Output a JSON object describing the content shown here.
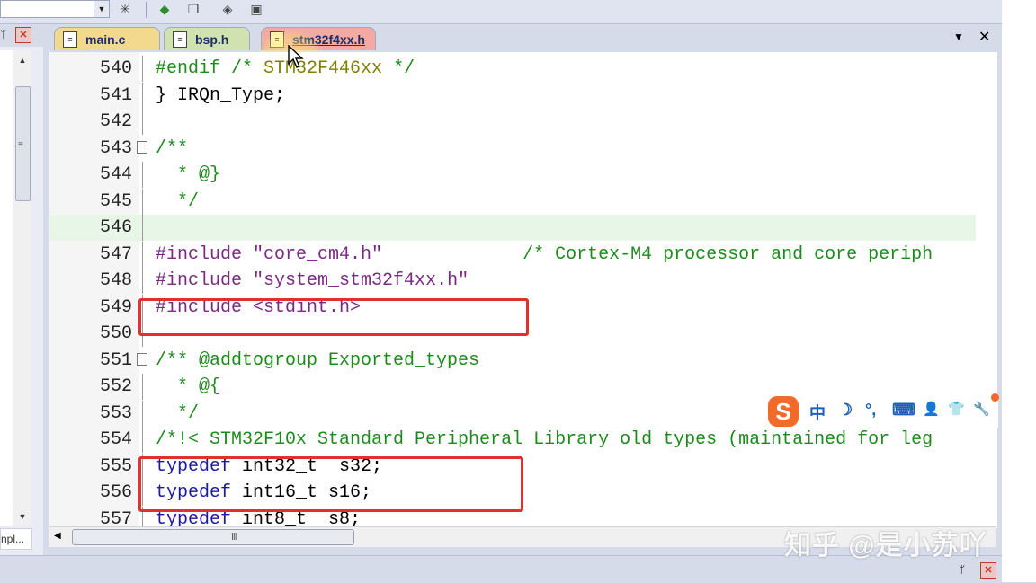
{
  "toolbar": {
    "icons": [
      "dropdown-arrow",
      "wand-icon",
      "component-icon",
      "window-icon",
      "diamond-icon",
      "pack-icon"
    ]
  },
  "left_panel": {
    "hscroll_text": "npl..."
  },
  "tabs": [
    {
      "label": "main.c",
      "color": "#f3d98e"
    },
    {
      "label": "bsp.h",
      "color": "#cfe2b0"
    },
    {
      "label": "stm32f4xx.h",
      "color": "#f2aaa2",
      "active": true
    }
  ],
  "tab_controls": {
    "dropdown": "▼",
    "close": "✕"
  },
  "editor": {
    "lines": [
      {
        "num": "540",
        "fold": "",
        "segments": [
          {
            "t": "#endif /* ",
            "c": "c-green"
          },
          {
            "t": "STM32F446xx",
            "c": "c-olive"
          },
          {
            "t": " */",
            "c": "c-green"
          }
        ]
      },
      {
        "num": "541",
        "fold": "",
        "segments": [
          {
            "t": "} IRQn_Type;",
            "c": "c-black"
          }
        ]
      },
      {
        "num": "542",
        "fold": "",
        "segments": []
      },
      {
        "num": "543",
        "fold": "⊟",
        "segments": [
          {
            "t": "/**",
            "c": "c-green"
          }
        ]
      },
      {
        "num": "544",
        "fold": "",
        "segments": [
          {
            "t": "  * @}",
            "c": "c-green"
          }
        ]
      },
      {
        "num": "545",
        "fold": "",
        "segments": [
          {
            "t": "  */",
            "c": "c-green"
          }
        ]
      },
      {
        "num": "546",
        "fold": "",
        "highlight": true,
        "segments": []
      },
      {
        "num": "547",
        "fold": "",
        "segments": [
          {
            "t": "#include ",
            "c": "c-purple"
          },
          {
            "t": "\"core_cm4.h\"",
            "c": "c-purple"
          },
          {
            "t": "             /* Cortex-M4 processor and core periph",
            "c": "c-green"
          }
        ]
      },
      {
        "num": "548",
        "fold": "",
        "segments": [
          {
            "t": "#include ",
            "c": "c-purple"
          },
          {
            "t": "\"system_stm32f4xx.h\"",
            "c": "c-purple"
          }
        ]
      },
      {
        "num": "549",
        "fold": "",
        "segments": [
          {
            "t": "#include <stdint.h>",
            "c": "c-purple"
          }
        ]
      },
      {
        "num": "550",
        "fold": "",
        "segments": []
      },
      {
        "num": "551",
        "fold": "⊟",
        "segments": [
          {
            "t": "/** @addtogroup Exported_types",
            "c": "c-green"
          }
        ]
      },
      {
        "num": "552",
        "fold": "",
        "segments": [
          {
            "t": "  * @{",
            "c": "c-green"
          }
        ]
      },
      {
        "num": "553",
        "fold": "",
        "segments": [
          {
            "t": "  */",
            "c": "c-green"
          }
        ]
      },
      {
        "num": "554",
        "fold": "",
        "segments": [
          {
            "t": "/*!< STM32F10x Standard Peripheral Library old types (maintained for leg",
            "c": "c-green"
          }
        ]
      },
      {
        "num": "555",
        "fold": "",
        "segments": [
          {
            "t": "typedef",
            "c": "c-blue"
          },
          {
            "t": " int32_t  s32;",
            "c": "c-black"
          }
        ]
      },
      {
        "num": "556",
        "fold": "",
        "segments": [
          {
            "t": "typedef",
            "c": "c-blue"
          },
          {
            "t": " int16_t s16;",
            "c": "c-black"
          }
        ]
      },
      {
        "num": "557",
        "fold": "",
        "segments": [
          {
            "t": "typedef",
            "c": "c-blue"
          },
          {
            "t": " int8_t  s8;",
            "c": "c-black"
          }
        ]
      }
    ]
  },
  "ime_bar": {
    "logo": "S",
    "items": [
      "中",
      "☽",
      "°,",
      "⌨",
      "👤",
      "👕",
      "🔧"
    ]
  },
  "watermark": "知乎 @是小苏吖",
  "colors": {
    "highlight_line": "#e8f6e8",
    "annotation_box": "#e03030",
    "ime_brand": "#f26a2a"
  }
}
